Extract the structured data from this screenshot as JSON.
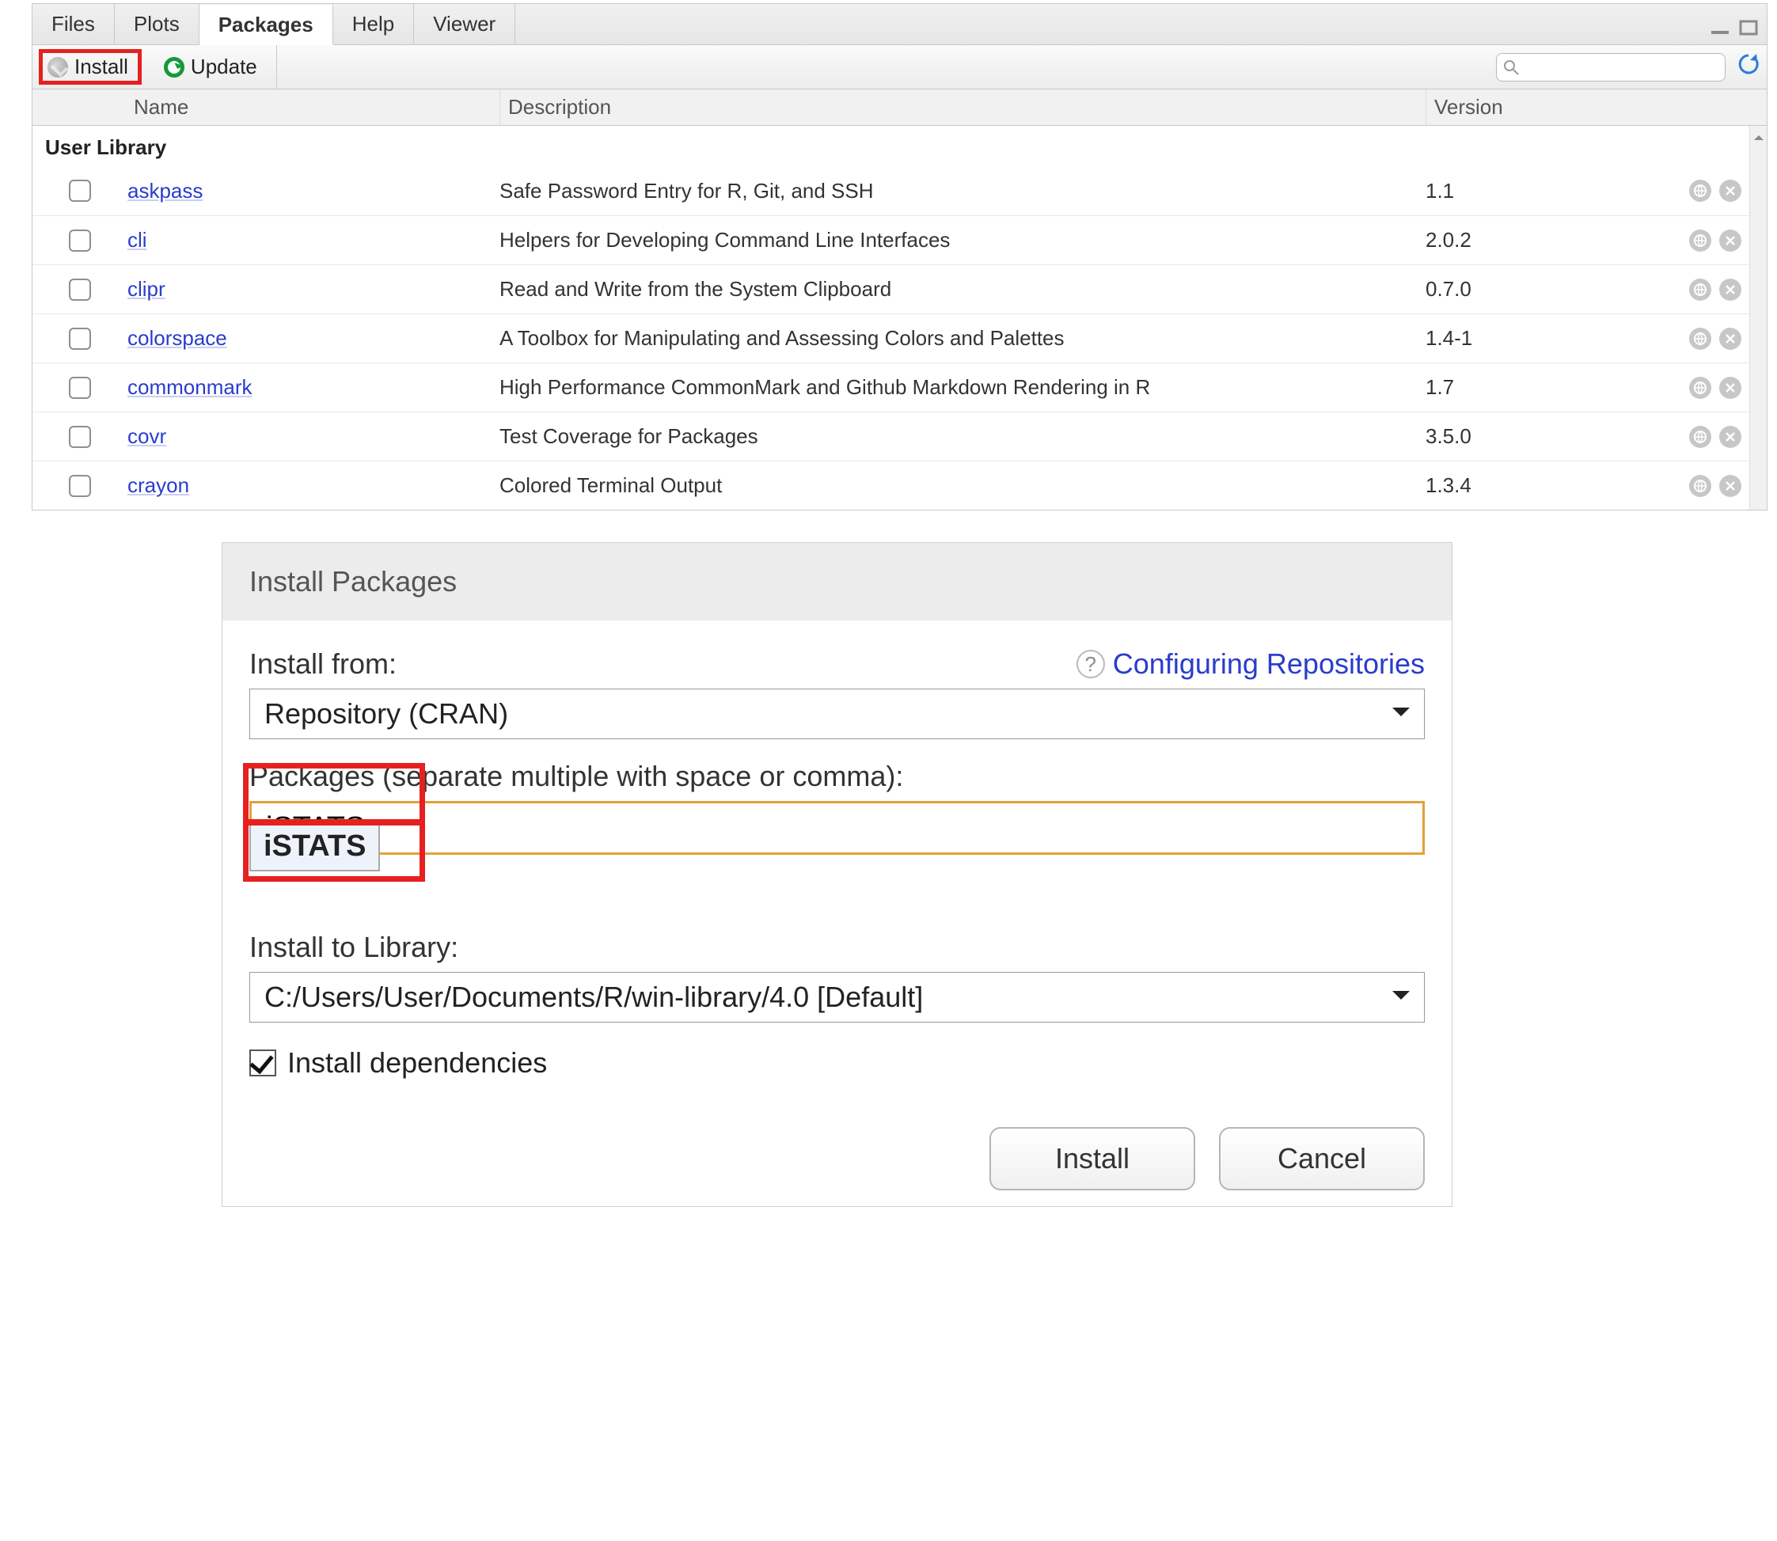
{
  "tabs": {
    "files": "Files",
    "plots": "Plots",
    "packages": "Packages",
    "help": "Help",
    "viewer": "Viewer"
  },
  "toolbar": {
    "install": "Install",
    "update": "Update",
    "search_placeholder": ""
  },
  "headers": {
    "name": "Name",
    "description": "Description",
    "version": "Version"
  },
  "group": "User Library",
  "packages": [
    {
      "name": "askpass",
      "desc": "Safe Password Entry for R, Git, and SSH",
      "ver": "1.1"
    },
    {
      "name": "cli",
      "desc": "Helpers for Developing Command Line Interfaces",
      "ver": "2.0.2"
    },
    {
      "name": "clipr",
      "desc": "Read and Write from the System Clipboard",
      "ver": "0.7.0"
    },
    {
      "name": "colorspace",
      "desc": "A Toolbox for Manipulating and Assessing Colors and Palettes",
      "ver": "1.4-1"
    },
    {
      "name": "commonmark",
      "desc": "High Performance CommonMark and Github Markdown Rendering in R",
      "ver": "1.7"
    },
    {
      "name": "covr",
      "desc": "Test Coverage for Packages",
      "ver": "3.5.0"
    },
    {
      "name": "crayon",
      "desc": "Colored Terminal Output",
      "ver": "1.3.4"
    }
  ],
  "dialog": {
    "title": "Install Packages",
    "install_from_label": "Install from:",
    "config_repos": "Configuring Repositories",
    "install_from_value": "Repository (CRAN)",
    "packages_label": "Packages (separate multiple with space or comma):",
    "packages_value": "iSTATS",
    "suggestion": "iSTATS",
    "install_to_label": "Install to Library:",
    "install_to_value": "C:/Users/User/Documents/R/win-library/4.0 [Default]",
    "deps_label": "Install dependencies",
    "install_btn": "Install",
    "cancel_btn": "Cancel"
  }
}
